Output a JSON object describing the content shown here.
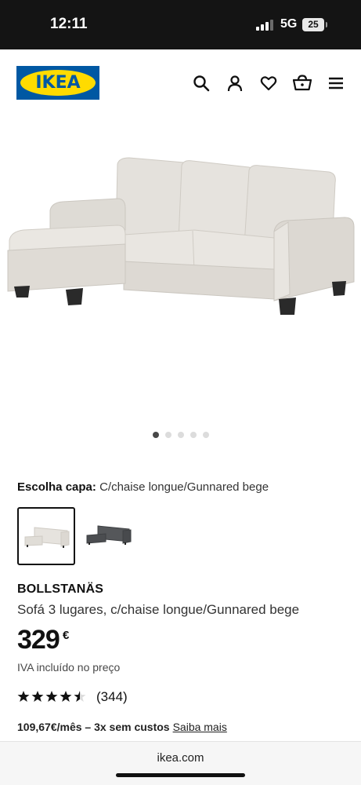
{
  "status_bar": {
    "time": "12:11",
    "network": "5G",
    "battery": "25"
  },
  "header": {
    "logo_text": "IKEA",
    "icons": [
      "search-icon",
      "account-icon",
      "heart-icon",
      "cart-icon",
      "menu-icon"
    ]
  },
  "gallery": {
    "slide_count": 5,
    "active_slide": 1
  },
  "variant": {
    "label": "Escolha capa:",
    "value": "C/chaise longue/Gunnared bege",
    "options": [
      "beige-sofa-variant",
      "dark-grey-sofa-variant"
    ],
    "selected_index": 0
  },
  "product": {
    "name": "BOLLSTANÄS",
    "description": "Sofá 3 lugares, c/chaise longue/Gunnared bege",
    "price": "329",
    "currency": "€",
    "vat_note": "IVA incluído no preço",
    "rating": 4.5,
    "reviews": "(344)",
    "installment": "109,67€/mês – 3x sem custos",
    "learn_more": "Saiba mais"
  },
  "browser": {
    "url": "ikea.com"
  },
  "colors": {
    "brand_blue": "#0058a3",
    "brand_yellow": "#ffdb00",
    "status_bar": "#141414"
  }
}
